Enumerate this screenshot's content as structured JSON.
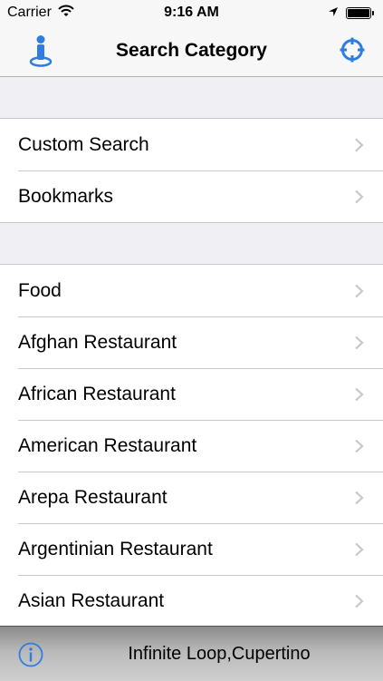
{
  "status_bar": {
    "carrier": "Carrier",
    "time": "9:16 AM",
    "wifi_icon": "wifi-icon",
    "location_icon": "location-arrow-icon",
    "battery_icon": "battery-full-icon"
  },
  "nav": {
    "title": "Search Category",
    "left_icon": "person-pin-icon",
    "right_icon": "crosshair-icon",
    "accent_color": "#2e7de1"
  },
  "sections": [
    {
      "items": [
        "Custom Search",
        "Bookmarks"
      ]
    },
    {
      "items": [
        "Food",
        "Afghan Restaurant",
        "African Restaurant",
        "American Restaurant",
        "Arepa Restaurant",
        "Argentinian Restaurant",
        "Asian Restaurant"
      ]
    }
  ],
  "toolbar": {
    "info_icon": "info-icon",
    "location_text": "Infinite Loop,Cupertino"
  }
}
